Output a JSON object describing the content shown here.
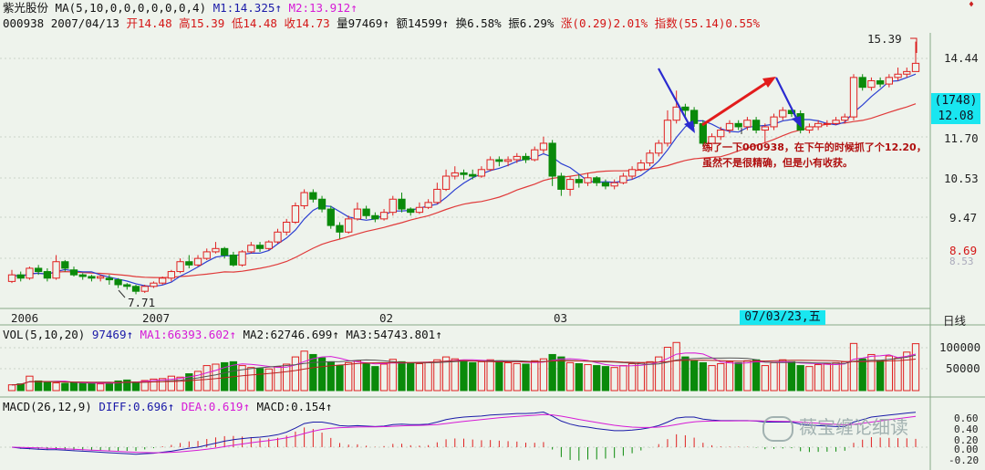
{
  "header": {
    "row1": {
      "stock_name": "紫光股份",
      "ma_params": "MA(5,10,0,0,0,0,0,0,4)",
      "m1": "M1:14.325",
      "m1_arrow": "↑",
      "m2": "M2:13.912",
      "m2_arrow": "↑"
    },
    "row2": {
      "code": "000938",
      "date": "2007/04/13",
      "open": "开14.48",
      "high": "高15.39",
      "low": "低14.48",
      "close": "收14.73",
      "volume": "量97469",
      "volume_arrow": "↑",
      "amount": "额14599",
      "amount_arrow": "↑",
      "turnover": "换6.58%",
      "amplitude": "振6.29%",
      "change": "涨(0.29)2.01%",
      "index": "指数(55.14)0.55%"
    }
  },
  "price_axis": {
    "ticks": [
      "14.44",
      "11.70",
      "10.53",
      "9.47"
    ],
    "red_tick": "8.69",
    "red_tick_sub": "8.53",
    "current_box": "(1748)",
    "current_price": "12.08",
    "high_label": "15.39",
    "low_label": "7.71"
  },
  "time_axis": {
    "labels": [
      "2006",
      "2007",
      "02",
      "03"
    ],
    "cursor_date": "07/03/23,五",
    "period": "日线"
  },
  "annotation": {
    "line1": "练了一下000938，在下午的时候抓了个12.20，",
    "line2": "虽然不是很精确，但是小有收获。"
  },
  "volume_panel": {
    "params": "VOL(5,10,20)",
    "value": "97469",
    "value_arrow": "↑",
    "ma1": "MA1:66393.602",
    "ma1_arrow": "↑",
    "ma2": "MA2:62746.699",
    "ma2_arrow": "↑",
    "ma3": "MA3:54743.801",
    "ma3_arrow": "↑",
    "ticks": [
      "100000",
      "50000"
    ]
  },
  "macd_panel": {
    "params": "MACD(26,12,9)",
    "diff": "DIFF:0.696",
    "diff_arrow": "↑",
    "dea": "DEA:0.619",
    "dea_arrow": "↑",
    "macd": "MACD:0.154",
    "macd_arrow": "↑",
    "ticks": [
      "0.60",
      "0.40",
      "0.20",
      "0.00",
      "-0.20"
    ]
  },
  "watermark": "薇宝缠论细读",
  "corner_mark": "♦",
  "colors": {
    "up": "#e02020",
    "down": "#0a8a0a",
    "ma_blue": "#2c3fd1",
    "ma_red": "#e03a3a",
    "background": "#eef3ec",
    "cursor_box": "#19e6f0"
  },
  "chart_data": {
    "type": "candlestick",
    "price_range": [
      7.5,
      15.6
    ],
    "candles": [
      [
        8.1,
        8.3,
        8.45,
        8.05
      ],
      [
        8.3,
        8.2,
        8.4,
        8.1
      ],
      [
        8.2,
        8.5,
        8.55,
        8.15
      ],
      [
        8.5,
        8.4,
        8.6,
        8.3
      ],
      [
        8.4,
        8.2,
        8.5,
        8.1
      ],
      [
        8.2,
        8.7,
        8.9,
        8.15
      ],
      [
        8.7,
        8.5,
        8.75,
        8.4
      ],
      [
        8.45,
        8.3,
        8.55,
        8.25
      ],
      [
        8.3,
        8.25,
        8.35,
        8.15
      ],
      [
        8.25,
        8.2,
        8.3,
        8.1
      ],
      [
        8.2,
        8.25,
        8.3,
        8.1
      ],
      [
        8.2,
        8.15,
        8.3,
        8.0
      ],
      [
        8.15,
        8.0,
        8.2,
        7.9
      ],
      [
        8.0,
        7.95,
        8.05,
        7.85
      ],
      [
        7.95,
        7.8,
        8.0,
        7.71
      ],
      [
        7.8,
        7.95,
        8.0,
        7.75
      ],
      [
        7.95,
        8.05,
        8.1,
        7.9
      ],
      [
        8.05,
        8.2,
        8.25,
        8.0
      ],
      [
        8.2,
        8.4,
        8.45,
        8.1
      ],
      [
        8.4,
        8.7,
        8.8,
        8.35
      ],
      [
        8.7,
        8.6,
        8.9,
        8.5
      ],
      [
        8.6,
        8.8,
        8.9,
        8.55
      ],
      [
        8.8,
        9.0,
        9.1,
        8.75
      ],
      [
        9.0,
        9.1,
        9.3,
        8.95
      ],
      [
        9.1,
        8.9,
        9.15,
        8.8
      ],
      [
        8.9,
        8.6,
        9.0,
        8.55
      ],
      [
        8.6,
        9.0,
        9.05,
        8.55
      ],
      [
        9.0,
        9.2,
        9.3,
        8.95
      ],
      [
        9.2,
        9.1,
        9.3,
        9.0
      ],
      [
        9.1,
        9.3,
        9.35,
        9.05
      ],
      [
        9.3,
        9.6,
        9.7,
        9.25
      ],
      [
        9.6,
        9.9,
        10.0,
        9.5
      ],
      [
        9.9,
        10.4,
        10.5,
        9.85
      ],
      [
        10.4,
        10.8,
        10.9,
        10.3
      ],
      [
        10.8,
        10.6,
        10.9,
        10.5
      ],
      [
        10.6,
        10.3,
        10.7,
        10.2
      ],
      [
        10.3,
        9.8,
        10.4,
        9.7
      ],
      [
        9.8,
        9.6,
        9.9,
        9.4
      ],
      [
        9.6,
        10.0,
        10.1,
        9.55
      ],
      [
        10.0,
        10.3,
        10.5,
        9.95
      ],
      [
        10.3,
        10.1,
        10.4,
        10.0
      ],
      [
        10.1,
        10.0,
        10.2,
        9.9
      ],
      [
        10.0,
        10.2,
        10.3,
        9.95
      ],
      [
        10.2,
        10.6,
        10.7,
        10.1
      ],
      [
        10.6,
        10.3,
        10.8,
        10.2
      ],
      [
        10.3,
        10.2,
        10.35,
        10.1
      ],
      [
        10.2,
        10.35,
        10.5,
        10.15
      ],
      [
        10.35,
        10.5,
        10.6,
        10.3
      ],
      [
        10.5,
        10.9,
        11.1,
        10.45
      ],
      [
        10.9,
        11.3,
        11.5,
        10.85
      ],
      [
        11.3,
        11.4,
        11.6,
        11.2
      ],
      [
        11.4,
        11.35,
        11.5,
        11.2
      ],
      [
        11.35,
        11.3,
        11.5,
        11.2
      ],
      [
        11.3,
        11.5,
        11.6,
        11.25
      ],
      [
        11.5,
        11.8,
        11.9,
        11.45
      ],
      [
        11.8,
        11.75,
        11.9,
        11.6
      ],
      [
        11.75,
        11.8,
        11.9,
        11.6
      ],
      [
        11.8,
        11.9,
        12.0,
        11.7
      ],
      [
        11.9,
        11.8,
        12.0,
        11.7
      ],
      [
        11.8,
        12.1,
        12.2,
        11.75
      ],
      [
        12.1,
        12.3,
        12.5,
        12.0
      ],
      [
        12.3,
        11.3,
        12.4,
        11.0
      ],
      [
        11.3,
        10.9,
        11.4,
        10.7
      ],
      [
        10.9,
        11.2,
        11.3,
        10.7
      ],
      [
        11.2,
        11.1,
        11.35,
        10.95
      ],
      [
        11.1,
        11.25,
        11.4,
        11.0
      ],
      [
        11.25,
        11.1,
        11.3,
        11.0
      ],
      [
        11.1,
        11.0,
        11.2,
        10.9
      ],
      [
        11.0,
        11.1,
        11.2,
        10.9
      ],
      [
        11.1,
        11.3,
        11.4,
        11.05
      ],
      [
        11.3,
        11.5,
        11.6,
        11.2
      ],
      [
        11.5,
        11.7,
        11.8,
        11.45
      ],
      [
        11.7,
        12.0,
        12.1,
        11.6
      ],
      [
        12.0,
        12.3,
        12.4,
        11.9
      ],
      [
        12.3,
        13.0,
        13.3,
        12.2
      ],
      [
        13.0,
        13.4,
        13.9,
        12.9
      ],
      [
        13.4,
        13.3,
        13.5,
        13.1
      ],
      [
        13.3,
        12.9,
        13.4,
        12.8
      ],
      [
        12.9,
        12.3,
        13.0,
        12.2
      ],
      [
        12.3,
        12.5,
        12.6,
        12.1
      ],
      [
        12.5,
        12.7,
        12.8,
        12.4
      ],
      [
        12.7,
        12.9,
        13.0,
        12.6
      ],
      [
        12.9,
        12.8,
        13.0,
        12.7
      ],
      [
        12.8,
        13.0,
        13.1,
        12.7
      ],
      [
        13.0,
        12.7,
        13.1,
        12.6
      ],
      [
        12.7,
        12.8,
        12.9,
        12.3
      ],
      [
        12.8,
        13.1,
        13.2,
        12.7
      ],
      [
        13.1,
        13.3,
        13.4,
        13.0
      ],
      [
        13.3,
        13.2,
        13.4,
        13.1
      ],
      [
        13.2,
        12.7,
        13.3,
        12.6
      ],
      [
        12.7,
        12.8,
        12.9,
        12.6
      ],
      [
        12.8,
        12.9,
        13.0,
        12.7
      ],
      [
        12.9,
        12.9,
        13.0,
        12.8
      ],
      [
        12.9,
        13.0,
        13.1,
        12.85
      ],
      [
        13.0,
        13.1,
        13.2,
        12.9
      ],
      [
        13.1,
        14.3,
        14.4,
        13.0
      ],
      [
        14.3,
        14.0,
        14.4,
        13.9
      ],
      [
        14.0,
        14.2,
        14.3,
        13.9
      ],
      [
        14.2,
        14.1,
        14.3,
        14.0
      ],
      [
        14.1,
        14.3,
        14.4,
        14.0
      ],
      [
        14.3,
        14.4,
        14.6,
        14.2
      ],
      [
        14.4,
        14.48,
        14.6,
        14.3
      ],
      [
        14.48,
        14.73,
        15.39,
        14.48
      ]
    ],
    "volume": [
      12000,
      14000,
      30000,
      20000,
      18000,
      16000,
      15000,
      17000,
      15000,
      16000,
      14000,
      15000,
      20000,
      22000,
      18000,
      21000,
      24000,
      25000,
      30000,
      28000,
      35000,
      40000,
      52000,
      55000,
      58000,
      60000,
      52000,
      48000,
      46000,
      45000,
      50000,
      55000,
      70000,
      82000,
      75000,
      68000,
      60000,
      52000,
      58000,
      62000,
      56000,
      50000,
      55000,
      65000,
      60000,
      58000,
      56000,
      58000,
      64000,
      70000,
      66000,
      62000,
      58000,
      60000,
      64000,
      62000,
      58000,
      56000,
      55000,
      62000,
      66000,
      75000,
      70000,
      58000,
      56000,
      54000,
      52000,
      50000,
      48000,
      52000,
      56000,
      58000,
      60000,
      70000,
      90000,
      100000,
      70000,
      62000,
      58000,
      52000,
      56000,
      60000,
      58000,
      62000,
      64000,
      52000,
      58000,
      64000,
      60000,
      52000,
      50000,
      54000,
      56000,
      58000,
      60000,
      98000,
      66000,
      75000,
      62000,
      72000,
      68000,
      80000,
      97469
    ],
    "ma_period_labels": [
      "M1",
      "M2"
    ],
    "macd_diff": [
      0.0,
      -0.02,
      -0.03,
      -0.04,
      -0.05,
      -0.05,
      -0.06,
      -0.07,
      -0.08,
      -0.09,
      -0.1,
      -0.11,
      -0.12,
      -0.13,
      -0.14,
      -0.13,
      -0.12,
      -0.1,
      -0.08,
      -0.05,
      -0.02,
      0.0,
      0.04,
      0.08,
      0.12,
      0.15,
      0.17,
      0.19,
      0.2,
      0.22,
      0.25,
      0.3,
      0.38,
      0.47,
      0.5,
      0.5,
      0.47,
      0.43,
      0.42,
      0.43,
      0.42,
      0.41,
      0.42,
      0.45,
      0.46,
      0.45,
      0.45,
      0.46,
      0.5,
      0.55,
      0.58,
      0.6,
      0.61,
      0.62,
      0.64,
      0.65,
      0.66,
      0.67,
      0.67,
      0.68,
      0.7,
      0.62,
      0.52,
      0.46,
      0.42,
      0.4,
      0.37,
      0.35,
      0.33,
      0.33,
      0.34,
      0.36,
      0.39,
      0.43,
      0.5,
      0.58,
      0.6,
      0.6,
      0.56,
      0.54,
      0.53,
      0.53,
      0.53,
      0.53,
      0.52,
      0.5,
      0.5,
      0.5,
      0.5,
      0.46,
      0.44,
      0.43,
      0.42,
      0.41,
      0.41,
      0.5,
      0.55,
      0.6,
      0.62,
      0.64,
      0.66,
      0.68,
      0.696
    ]
  }
}
